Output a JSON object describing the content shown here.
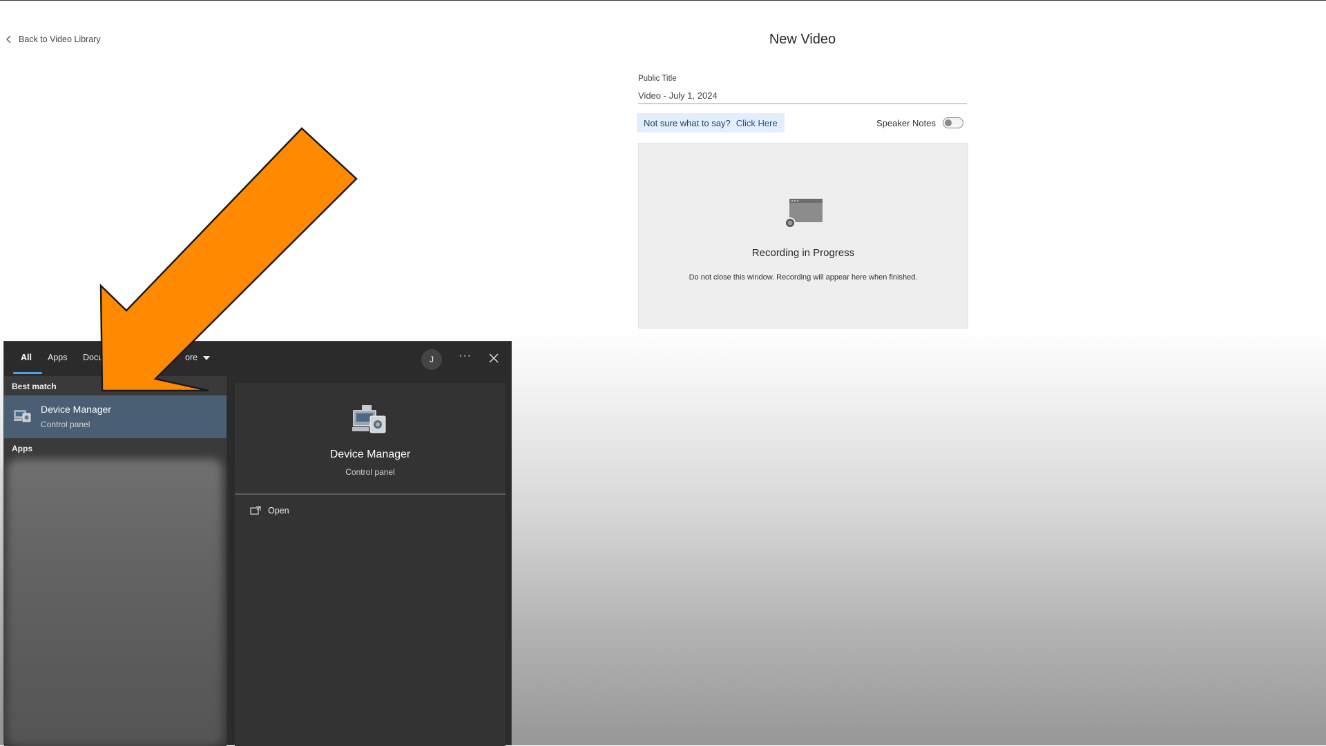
{
  "header": {
    "back_label": "Back to Video Library",
    "page_title": "New Video"
  },
  "form": {
    "public_title_label": "Public Title",
    "public_title_value": "Video - July 1, 2024",
    "hint_prefix": "Not sure what to say?",
    "hint_link": "Click Here",
    "speaker_notes_label": "Speaker Notes",
    "speaker_notes_on": false
  },
  "recording": {
    "title": "Recording in Progress",
    "subtitle": "Do not close this window. Recording will appear here when finished."
  },
  "search_popup": {
    "tabs": [
      {
        "label": "All",
        "active": true
      },
      {
        "label": "Apps"
      },
      {
        "label": "Docu"
      },
      {
        "label": "ore"
      }
    ],
    "user_initial": "J",
    "more_label": "···",
    "best_match_label": "Best match",
    "best_match": {
      "name": "Device Manager",
      "type": "Control panel",
      "icon": "device-manager-icon"
    },
    "apps_label": "Apps",
    "detail": {
      "name": "Device Manager",
      "type": "Control panel"
    },
    "open_label": "Open"
  },
  "annotation": {
    "arrow_color": "#ff8a00"
  }
}
